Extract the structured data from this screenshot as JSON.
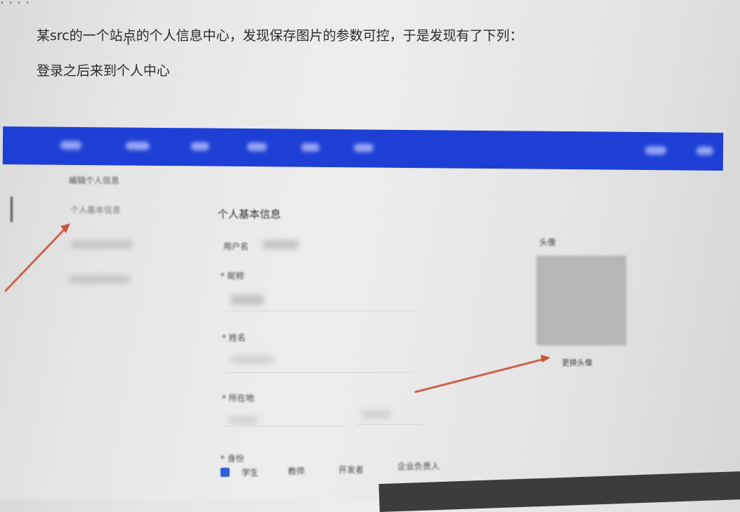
{
  "document": {
    "line1": "某src的一个站点的个人信息中心，发现保存图片的参数可控，于是发现有了下列：",
    "line2": "登录之后来到个人中心"
  },
  "sidebar": {
    "items": [
      "编辑个人信息",
      "个人基本信息"
    ]
  },
  "profile": {
    "title": "个人基本信息",
    "username_label": "用户名",
    "nickname_label": "* 昵称",
    "name_label": "* 姓名",
    "location_label": "* 所在地",
    "identity_label": "* 身份",
    "identity_options": [
      "学生",
      "教师",
      "开发者",
      "企业负责人"
    ],
    "identity_checked": "学生"
  },
  "avatar": {
    "label": "头像",
    "change_button": "更换头像"
  },
  "colors": {
    "header_blue": "#1e3fd6",
    "annotation_arrow": "#c8553a",
    "checkbox_blue": "#2b5fd9"
  }
}
